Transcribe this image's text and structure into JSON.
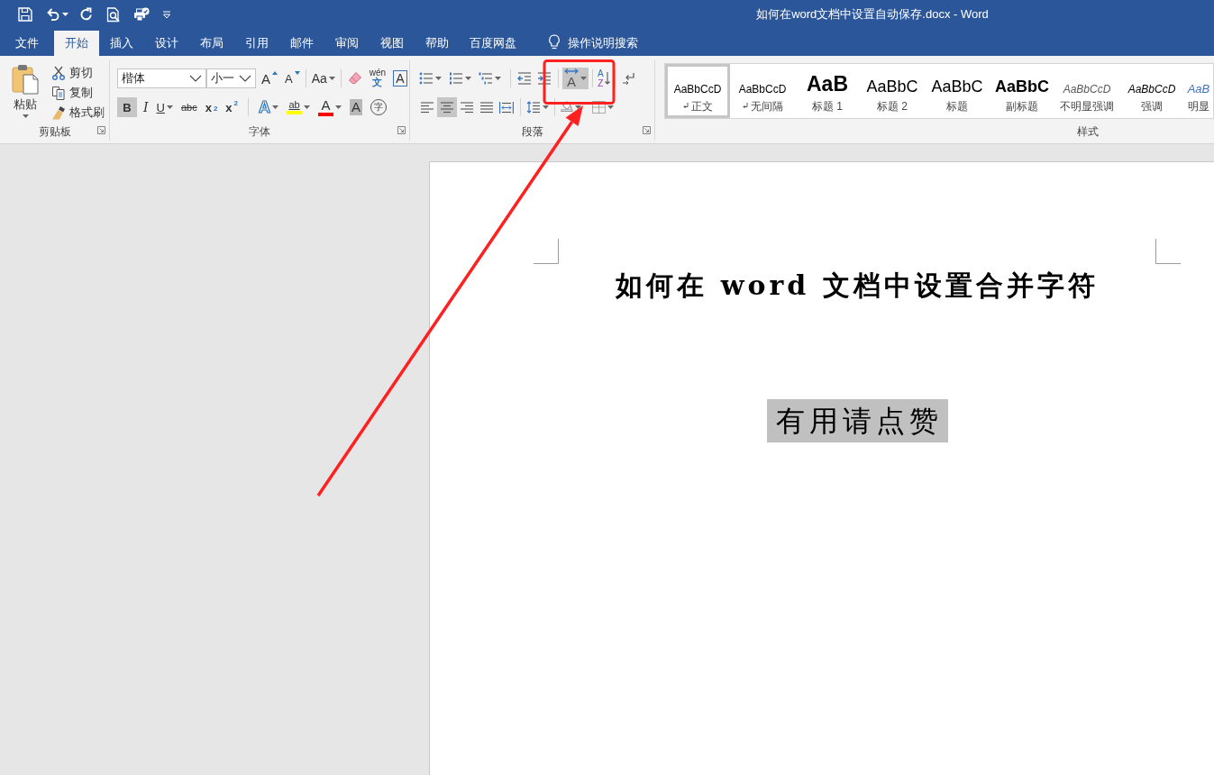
{
  "window": {
    "title": "如何在word文档中设置自动保存.docx - Word"
  },
  "tabs": [
    {
      "label": "文件",
      "selected": false
    },
    {
      "label": "开始",
      "selected": true
    },
    {
      "label": "插入",
      "selected": false
    },
    {
      "label": "设计",
      "selected": false
    },
    {
      "label": "布局",
      "selected": false
    },
    {
      "label": "引用",
      "selected": false
    },
    {
      "label": "邮件",
      "selected": false
    },
    {
      "label": "审阅",
      "selected": false
    },
    {
      "label": "视图",
      "selected": false
    },
    {
      "label": "帮助",
      "selected": false
    },
    {
      "label": "百度网盘",
      "selected": false
    }
  ],
  "tell_me": {
    "placeholder": "操作说明搜索"
  },
  "clipboard": {
    "title": "剪贴板",
    "paste": "粘贴",
    "commands": [
      {
        "kind": "cut",
        "label": "剪切"
      },
      {
        "kind": "copy",
        "label": "复制"
      },
      {
        "kind": "format-painter",
        "label": "格式刷"
      }
    ]
  },
  "font": {
    "title": "字体",
    "font_name": "楷体",
    "font_size": "小一",
    "grow": "A",
    "shrink": "A",
    "change_case": "Aa",
    "phonetic": {
      "top": "wén",
      "bottom": "文"
    },
    "border": "A",
    "bold": {
      "label": "B",
      "on": true
    },
    "italic": {
      "label": "I",
      "on": false
    },
    "underline": {
      "label": "U",
      "on": false
    },
    "strikethrough": "abc",
    "subscript": "x$_{2}$",
    "superscript": "x$^{2}$",
    "text_effects": "A",
    "highlight": {
      "label": "ab",
      "color": "#ffff00"
    },
    "font_color": {
      "label": "A",
      "color": "#ff0000"
    },
    "shading": "A",
    "enclose": "字"
  },
  "paragraph": {
    "title": "段落",
    "asian_layout": {
      "label": "A",
      "on": true
    },
    "sort": {
      "top": "A",
      "bottom": "Z"
    },
    "alignment": [
      {
        "selected": false
      },
      {
        "selected": true
      },
      {
        "selected": false
      },
      {
        "selected": false
      },
      {
        "selected": false
      }
    ]
  },
  "styles": {
    "title": "样式",
    "items": [
      {
        "kind": "normal",
        "preview": "AaBbCcD",
        "name": "正文",
        "paragraph_mark": true,
        "selected": true
      },
      {
        "kind": "normal",
        "preview": "AaBbCcD",
        "name": "无间隔",
        "paragraph_mark": true,
        "selected": false
      },
      {
        "kind": "heading1",
        "preview": "AaB",
        "name": "标题 1",
        "paragraph_mark": false,
        "selected": false
      },
      {
        "kind": "heading2",
        "preview": "AaBbC",
        "name": "标题 2",
        "paragraph_mark": false,
        "selected": false
      },
      {
        "kind": "title",
        "preview": "AaBbC",
        "name": "标题",
        "paragraph_mark": false,
        "selected": false
      },
      {
        "kind": "subtitle",
        "preview": "AaBbC",
        "name": "副标题",
        "paragraph_mark": false,
        "selected": false
      },
      {
        "kind": "subtle-emphasis",
        "preview": "AaBbCcD",
        "name": "不明显强调",
        "paragraph_mark": false,
        "selected": false
      },
      {
        "kind": "emphasis",
        "preview": "AaBbCcD",
        "name": "强调",
        "paragraph_mark": false,
        "selected": false
      },
      {
        "kind": "intense-emphasis",
        "preview": "AaB",
        "name": "明显",
        "paragraph_mark": false,
        "selected": false
      }
    ]
  },
  "document": {
    "title": "如何在 word 文档中设置合并字符",
    "note": {
      "text": "有用请点赞",
      "shaded": true
    }
  }
}
